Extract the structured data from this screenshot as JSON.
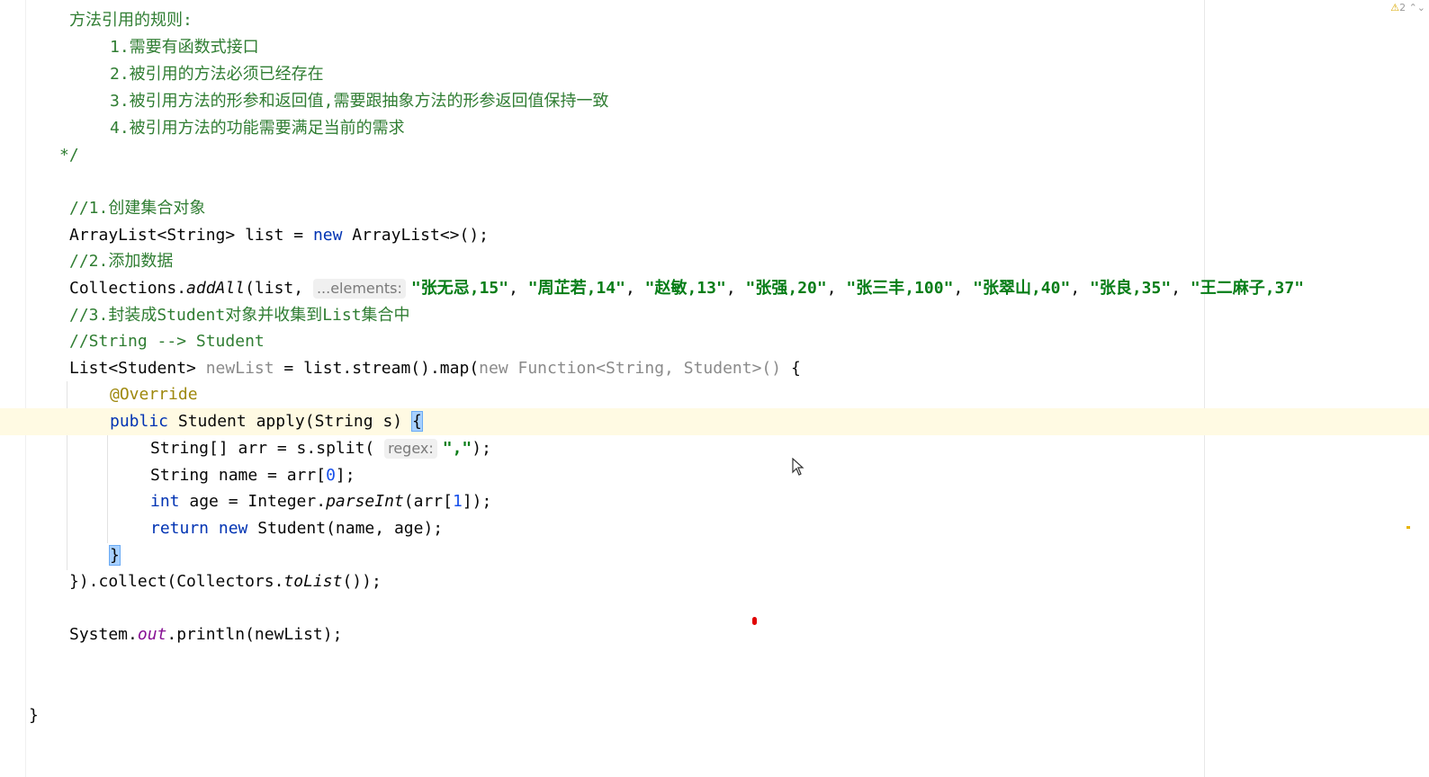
{
  "toolbar": {
    "warning_icon": "warning-triangle-icon",
    "warning_count": "2",
    "up_icon": "chevron-up-icon",
    "down_icon": "chevron-down-icon"
  },
  "comment": {
    "title": "方法引用的规则:",
    "rule1": "1.需要有函数式接口",
    "rule2": "2.被引用的方法必须已经存在",
    "rule3": "3.被引用方法的形参和返回值,需要跟抽象方法的形参返回值保持一致",
    "rule4": "4.被引用方法的功能需要满足当前的需求",
    "end": "*/"
  },
  "code": {
    "c1": "//1.创建集合对象",
    "l_list_a": "ArrayList<String> list = ",
    "kw_new": "new",
    "l_list_b": " ArrayList<>();",
    "c2": "//2.添加数据",
    "l_add_a": "Collections.",
    "l_add_m": "addAll",
    "l_add_b": "(list, ",
    "hint_elements": "...elements:",
    "s1": "\"张无忌,15\"",
    "s2": "\"周芷若,14\"",
    "s3": "\"赵敏,13\"",
    "s4": "\"张强,20\"",
    "s5": "\"张三丰,100\"",
    "s6": "\"张翠山,40\"",
    "s7": "\"张良,35\"",
    "s8": "\"王二麻子,37\"",
    "comma": ", ",
    "c3": "//3.封装成Student对象并收集到List集合中",
    "c4": "//String --> Student",
    "l_map_a": "List<Student> ",
    "l_map_var": "newList",
    "l_map_b": " = list.stream().map(",
    "l_map_new": "new Function<String, Student>()",
    "l_map_c": " {",
    "ann": "@Override",
    "kw_public": "public",
    "l_apply_a": " Student apply(String s) ",
    "brace_open": "{",
    "l_split_a": "String[] arr = s.split( ",
    "hint_regex": "regex:",
    "s_comma": "\",\"",
    "l_split_b": ");",
    "l_name_a": "String name = arr[",
    "n0": "0",
    "l_name_b": "];",
    "kw_int": "int",
    "l_age_a": " age = Integer.",
    "l_age_m": "parseInt",
    "l_age_b": "(arr[",
    "n1": "1",
    "l_age_c": "]);",
    "kw_return": "return",
    "kw_new2": "new",
    "l_ret_b": " Student(name, age);",
    "brace_close": "}",
    "l_collect_a": "}).collect(Collectors.",
    "l_collect_m": "toList",
    "l_collect_b": "());",
    "l_print_a": "System.",
    "l_print_f": "out",
    "l_print_b": ".println(newList);",
    "class_close": "}"
  }
}
